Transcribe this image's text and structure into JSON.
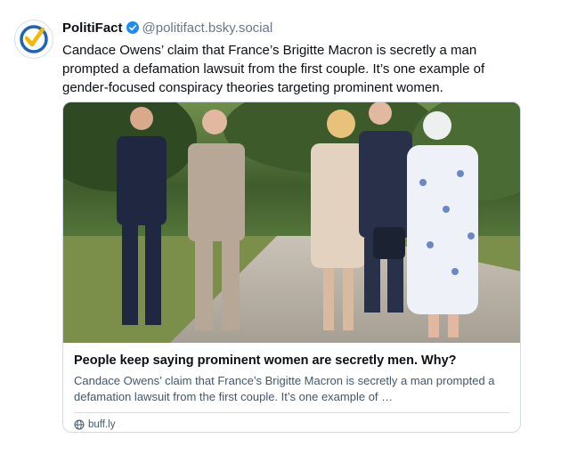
{
  "post": {
    "avatar_icon": "politifact-check-logo-icon",
    "display_name": "PolitiFact",
    "verified_icon": "verified-check-icon",
    "handle": "@politifact.bsky.social",
    "text": "Candace Owens’ claim that France’s Brigitte Macron is secretly a man prompted a defamation lawsuit from the first couple. It’s one example of gender-focused conspiracy theories targeting prominent women."
  },
  "link_card": {
    "image_alt": "photo of five people walking on a path",
    "title": "People keep saying prominent women are secretly men. Why?",
    "description": "Candace Owens’ claim that France’s Brigitte Macron is secretly a man prompted a defamation lawsuit from the first couple. It’s one example of …",
    "domain_icon": "globe-icon",
    "domain": "buff.ly"
  },
  "colors": {
    "handle": "#66788a",
    "verified_blue": "#1d8cf8",
    "brand_blue": "#1e63b5",
    "brand_yellow": "#f5b700",
    "card_border": "#d4dbe2"
  }
}
